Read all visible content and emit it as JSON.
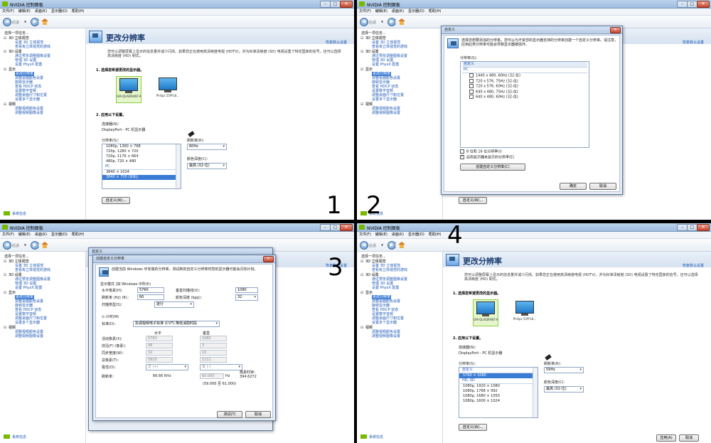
{
  "app": {
    "title": "NVIDIA 控制面板",
    "menu": [
      "文件(F)",
      "编辑(E)",
      "桌面(K)",
      "显示器(D)",
      "帮助(H)"
    ],
    "back_label": "后退",
    "sidebar_heading": "选择一项任务...",
    "tree": [
      {
        "label": "3D 设置",
        "items": [
          "通过预览调整图像设置",
          "管理 3D 设置",
          "设置 PhysX 配置"
        ]
      },
      {
        "label": "显示",
        "items": [
          "更改分辨率",
          "调整桌面颜色设置",
          "旋转显示器",
          "查看 HDCP 状态",
          "设置数字音频",
          "调整桌面尺寸和位置",
          "设置多个显示器"
        ]
      },
      {
        "label": "视频",
        "items": [
          "调整视频颜色设置",
          "调整视频图像设置"
        ]
      }
    ],
    "tree_top_group": {
      "label": "3D 立体视觉",
      "items": [
        "设置 3D 立体视觉",
        "查看有立体视觉的游戏"
      ]
    },
    "system_info": "系统信息"
  },
  "page": {
    "title": "更改分辨率",
    "restore": "恢复默认设置",
    "description": "您可以调整屏幕上显示的信息量并减少闪烁。如果您正在使用高清晰度电视 (HDTV)，并为标准清晰度 (SD) 电视设置了特定国家的信号，还可以选择高清晰度 (HD) 制式。",
    "section1": "1. 选择您希望更改的显示器。",
    "monitor1": "GM-QUADRANT-A",
    "monitor2": "Philips 55PFL8...",
    "section2": "2. 应用以下设置。",
    "connector_label": "连接器(N)：",
    "connector_value": "DisplayPort - PC 机显示器",
    "resolution_label": "分辨率(S)：",
    "refresh_label": "刷新率(R)：",
    "refresh_value": "60Hz",
    "depth_label": "颜色深度(C)：",
    "depth_value": "最高 (32-位)",
    "customize": "自定义(W)...",
    "apply": "应用(A)",
    "cancel": "取消"
  },
  "p1": {
    "resolutions": [
      "1080p, 1360 × 768",
      "720p, 1280 × 720",
      "720p, 1176 × 664",
      "480p, 720 × 480"
    ],
    "pc_label": "PC",
    "pc_items": [
      "3840 × 1024",
      "3840 × 720 (本机)"
    ],
    "num": "1"
  },
  "p2": {
    "dlg_title": "自定义",
    "dlg_desc": "选择您想要添加的分辨率。您可以为不受您的显示器支持的分辨率创建一个自定义分辨率。请注意，应用此类分辨率可能会导致显示器被损坏。",
    "list_label": "分辨率(S)：",
    "custom_cat": "自定义",
    "pc_label": "PC",
    "items": [
      "1440 x 480, 60Hz (32-位)",
      "720 x 576, 75Hz (32-位)",
      "720 x 576, 60Hz (32-位)",
      "640 x 480, 75Hz (32-位)",
      "640 x 480, 60Hz (32-位)"
    ],
    "chk8bit": "8 位和 16 位分辨率(I)",
    "chk_enable": "启用显示器未显示的分辨率(E)",
    "create_btn": "创建自定义分辨率(C)",
    "ok": "确定",
    "cancel": "取消",
    "num": "2"
  },
  "p3": {
    "outer_title": "自定义",
    "dlg_title": "创建自定义分辨率",
    "dlg_desc": "创建当前 Windows 中安装的分辨率。测试新的自定义分辨率时您的显示器可能会闪烁片刻。",
    "display_mode": "显示模式 (如 Windows 中所示)",
    "h_pixels_label": "水平像素(H)：",
    "h_pixels": "5760",
    "v_lines_label": "垂直扫描线(V)：",
    "v_lines": "1080",
    "refresh_label": "刷新率 (Hz) (R)：",
    "refresh": "60",
    "depth_label": "颜色深度 (bpp)：",
    "depth": "32",
    "scan_label": "扫描类型(S)：",
    "scan": "逐行",
    "timing": "计时(M)",
    "standard_label": "标准(D)：",
    "standard": "协调视频电子标准 (CVT) 降低消隐时段",
    "col_h": "水平",
    "col_v": "垂直",
    "rows": [
      {
        "label": "活动像素(X)：",
        "h": "5760",
        "v": "1080"
      },
      {
        "label": "前沿(F) (像素)：",
        "h": "48",
        "v": "3"
      },
      {
        "label": "同步宽度(W)：",
        "h": "32",
        "v": "10"
      },
      {
        "label": "总像素(T)：",
        "h": "5920",
        "v": "1111"
      },
      {
        "label": "极性(O)：",
        "h": "正 (+)",
        "v": "负 (-)"
      }
    ],
    "refresh_rate_label": "刷新率：",
    "refresh_khz": "66.66 KHz",
    "refresh_hz": "60.000",
    "hz_unit": "Hz",
    "pixel_clock_label": "像素时钟：",
    "pixel_clock": "394.6272",
    "range": "(59.000 至 61.000)",
    "test_btn": "测试(T)",
    "cancel": "取消",
    "num": "3"
  },
  "p4": {
    "list": [
      "自定义",
      "5760 × 1080",
      "HD, SD",
      "1080p, 1920 × 1080",
      "1080p, 1768 × 992",
      "1080p, 1680 × 1050",
      "1080p, 1600 × 1024"
    ],
    "refresh_value": "59Hz",
    "num": "4"
  }
}
